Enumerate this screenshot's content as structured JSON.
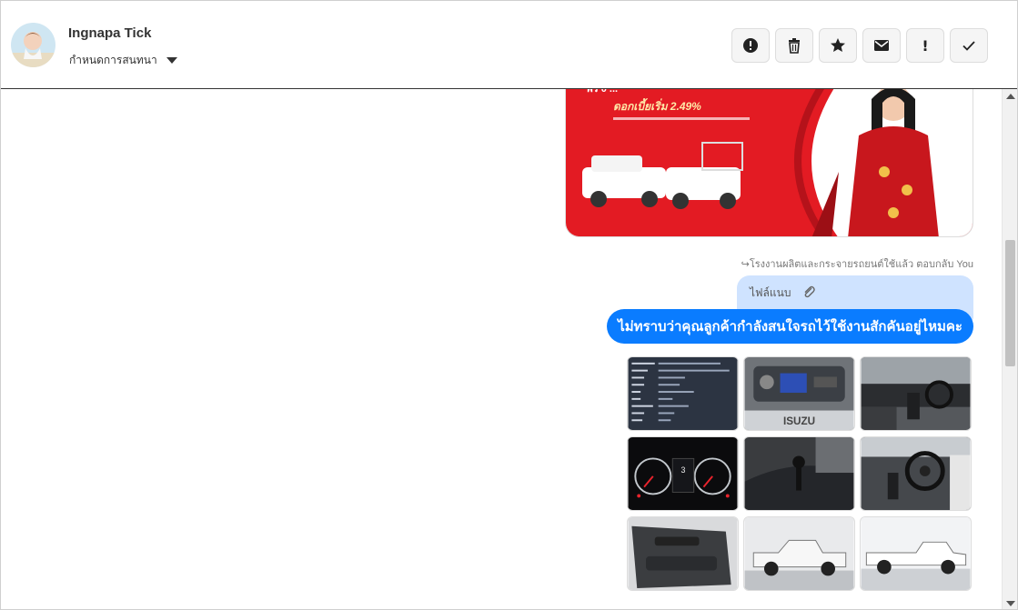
{
  "header": {
    "contact_name": "Ingnapa Tick",
    "conversation_menu": "กำหนดการสนทนา"
  },
  "toolbar": {
    "buttons": [
      {
        "name": "spam",
        "icon": "alert-circle-icon"
      },
      {
        "name": "delete",
        "icon": "trash-icon"
      },
      {
        "name": "star",
        "icon": "star-icon"
      },
      {
        "name": "unread",
        "icon": "envelope-icon"
      },
      {
        "name": "important",
        "icon": "exclamation-icon",
        "label": "!"
      },
      {
        "name": "done",
        "icon": "check-icon"
      }
    ]
  },
  "promo": {
    "headline": "ดอกเบี้ยเริ่ม 2.49%"
  },
  "thread": {
    "reply_note": "โรงงานผลิตและกระจายรถยนต์ใช้แล้ว ตอบกลับ You",
    "attachment_label": "ไฟล์แนบ",
    "message_text": "ไม่ทราบว่าคุณลูกค้ากำลังสนใจรถไว้ใช้งานสักคันอยู่ไหมคะ"
  },
  "gallery": {
    "logo_text": "ISUZU",
    "speedo_text": "3"
  },
  "colors": {
    "message_bubble": "#0a7cff",
    "attachment_bubble": "#cfe3ff",
    "promo_red": "#e31b23"
  }
}
